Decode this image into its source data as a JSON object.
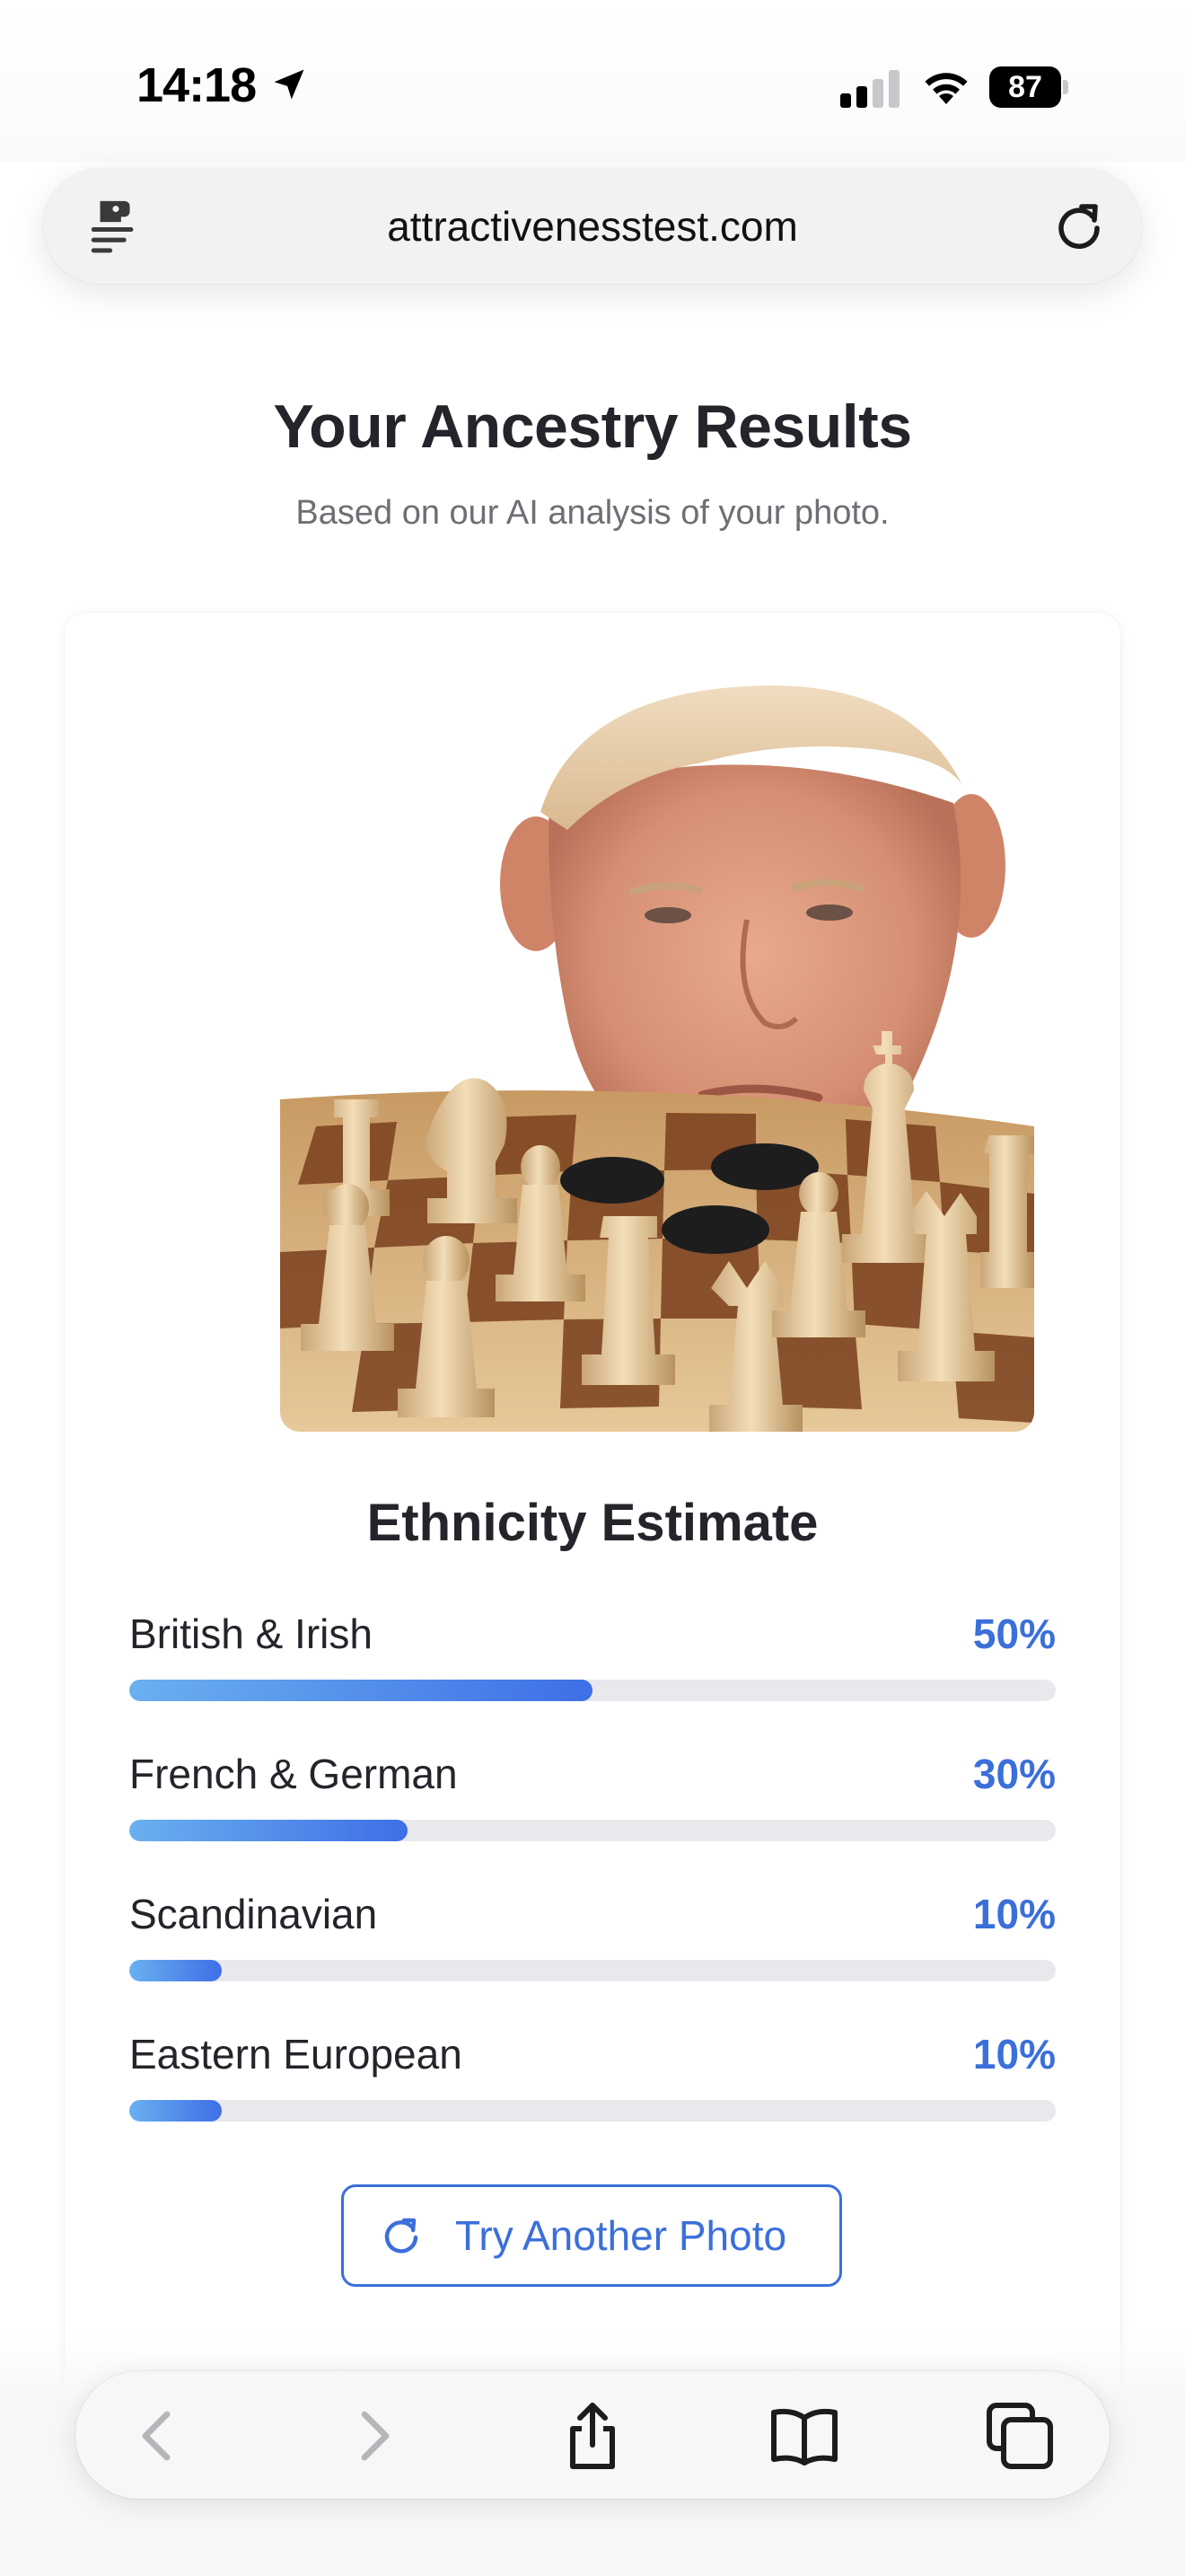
{
  "status": {
    "time": "14:18",
    "battery": "87"
  },
  "browser": {
    "url": "attractivenesstest.com"
  },
  "page": {
    "title": "Your Ancestry Results",
    "subtitle": "Based on our AI analysis of your photo."
  },
  "results": {
    "section_title": "Ethnicity Estimate",
    "items": [
      {
        "label": "British & Irish",
        "percent_text": "50%",
        "value": 50
      },
      {
        "label": "French & German",
        "percent_text": "30%",
        "value": 30
      },
      {
        "label": "Scandinavian",
        "percent_text": "10%",
        "value": 10
      },
      {
        "label": "Eastern European",
        "percent_text": "10%",
        "value": 10
      }
    ],
    "retry_label": "Try Another Photo"
  },
  "colors": {
    "accent": "#3b6fd9",
    "bar_start": "#6ab0f0",
    "bar_end": "#3e6fe6",
    "track": "#e9e9ed"
  },
  "icons": {
    "status": [
      "location-arrow-icon",
      "cellular-signal-icon",
      "wifi-icon",
      "battery-icon"
    ],
    "urlbar": [
      "reader-mode-icon",
      "reload-icon"
    ],
    "toolbar": [
      "back-icon",
      "forward-icon",
      "share-icon",
      "bookmarks-icon",
      "tabs-icon"
    ]
  }
}
